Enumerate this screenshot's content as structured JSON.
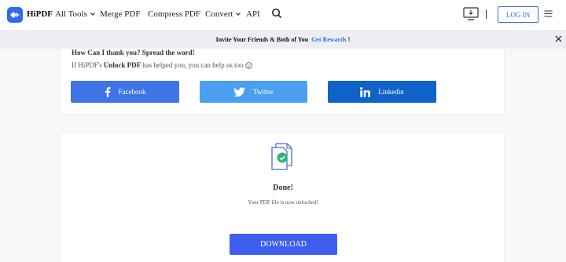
{
  "header": {
    "logo_text": "HiPDF",
    "nav": [
      {
        "label": "All Tools",
        "has_dropdown": true
      },
      {
        "label": "Merge PDF",
        "has_dropdown": false
      },
      {
        "label": "Compress PDF",
        "has_dropdown": false
      },
      {
        "label": "Convert",
        "has_dropdown": true
      },
      {
        "label": "API",
        "has_dropdown": false
      }
    ],
    "login_label": "LOG IN",
    "icons": [
      "search-icon",
      "desktop-download-icon",
      "menu-icon"
    ]
  },
  "banner": {
    "text_before": "Invite Your Friends & Both of You",
    "link": "Get Rewards",
    "text_after": "!"
  },
  "share": {
    "title": "How Can I thank you? Spread the word!",
    "sub_prefix": "If HiPDF's",
    "sub_bold": "Unlock PDF",
    "sub_suffix": "has helped you, you can help us too",
    "buttons": {
      "facebook": "Facebook",
      "twitter": "Twitter",
      "linkedin": "Linkedin"
    }
  },
  "result": {
    "title": "Done!",
    "message": "Your PDF file is now unlocked!",
    "download_label": "DOWNLOAD"
  },
  "colors": {
    "accent": "#2f6bf0",
    "facebook": "#3f74e6",
    "twitter": "#4a9ff0",
    "linkedin": "#0f62c8",
    "download": "#3f5ef0",
    "success": "#2bb673"
  }
}
